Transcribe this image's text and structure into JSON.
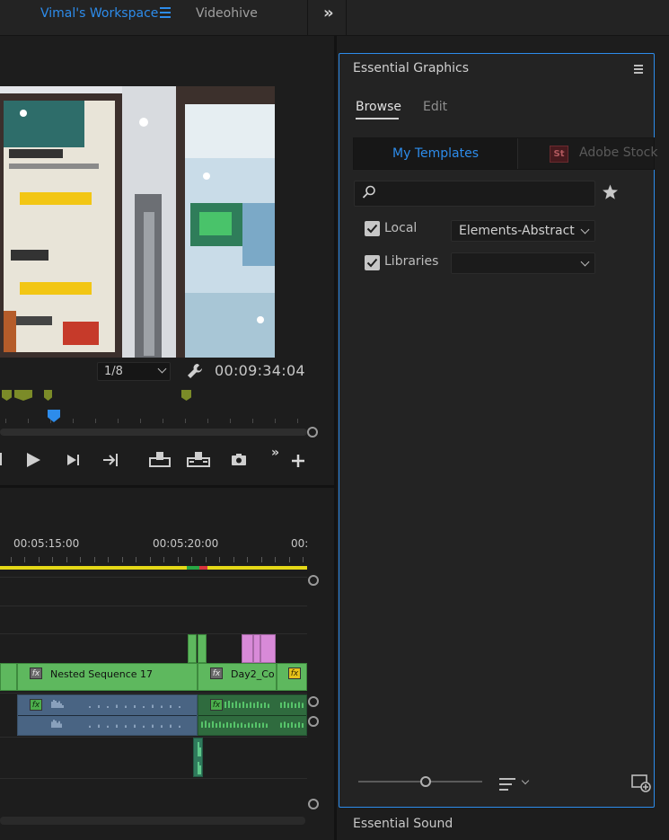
{
  "workspace": {
    "active_label": "Vimal's Workspace",
    "other_label": "Videohive",
    "more_glyph": "»"
  },
  "program_monitor": {
    "zoom_value": "1/8",
    "timecode": "00:09:34:04",
    "marker_color": "#7b8b28",
    "playhead_color": "#2d8ceb"
  },
  "timeline": {
    "timecodes": [
      "00:05:15:00",
      "00:05:20:00",
      "00:"
    ],
    "work_area_color": "#e5d817",
    "clips": {
      "nested_label": "Nested Sequence 17",
      "day2_label": "Day2_Co",
      "fx_glyph": "fx"
    }
  },
  "essential_graphics": {
    "title": "Essential Graphics",
    "tabs": [
      "Browse",
      "Edit"
    ],
    "active_tab": "Browse",
    "sources": {
      "my_templates": "My Templates",
      "stock_icon": "St",
      "adobe_stock": "Adobe Stock"
    },
    "search": {
      "value": "",
      "placeholder": ""
    },
    "local": {
      "label": "Local",
      "checked": true,
      "dropdown_value": "Elements-Abstract"
    },
    "libraries": {
      "label": "Libraries",
      "checked": true,
      "dropdown_value": ""
    },
    "accent_color": "#2d8ceb"
  },
  "essential_sound": {
    "title": "Essential Sound"
  }
}
